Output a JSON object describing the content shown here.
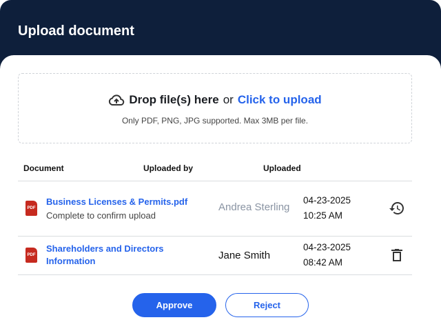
{
  "header": {
    "title": "Upload document"
  },
  "dropzone": {
    "drop_text": "Drop file(s) here",
    "or_text": "or",
    "link_text": "Click to upload",
    "hint": "Only PDF, PNG, JPG supported. Max 3MB per file."
  },
  "table": {
    "columns": [
      "Document",
      "Uploaded by",
      "Uploaded"
    ],
    "rows": [
      {
        "file_icon": "PDF",
        "name": "Business Licenses & Permits.pdf",
        "status": "Complete to confirm upload",
        "uploaded_by": "Andrea Sterling",
        "date": "04-23-2025",
        "time": "10:25 AM",
        "action_icon": "history-icon"
      },
      {
        "file_icon": "PDF",
        "name_line1": "Shareholders and Directors",
        "name_line2": "Information",
        "uploaded_by": "Jane Smith",
        "date": "04-23-2025",
        "time": "08:42 AM",
        "action_icon": "trash-icon"
      }
    ]
  },
  "actions": {
    "approve": "Approve",
    "reject": "Reject"
  },
  "colors": {
    "header_bg": "#0e1f3b",
    "accent": "#2563eb",
    "pdf": "#c62a1f"
  }
}
